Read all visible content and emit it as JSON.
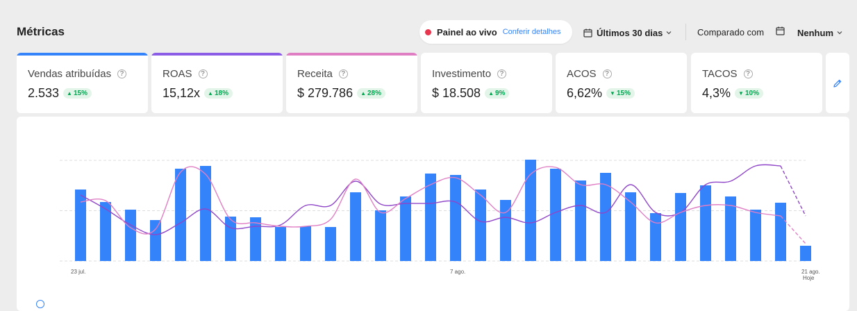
{
  "header": {
    "title": "Métricas",
    "live": {
      "label": "Painel ao vivo",
      "link": "Conferir detalhes"
    },
    "period": {
      "label": "Últimos 30 dias"
    },
    "compare": {
      "label": "Comparado com",
      "value": "Nenhum"
    }
  },
  "colors": {
    "accent_blue": "#3483fa",
    "live_red": "#e8364f",
    "positive_green": "#00a650",
    "line_purple": "#8f46c8",
    "line_pink": "#e07ec4"
  },
  "metrics": [
    {
      "label": "Vendas atribuídas",
      "value": "2.533",
      "change": "15%",
      "direction": "up",
      "accent": "#3483fa"
    },
    {
      "label": "ROAS",
      "value": "15,12x",
      "change": "18%",
      "direction": "up",
      "accent": "#8b5ce6"
    },
    {
      "label": "Receita",
      "value": "$ 279.786",
      "change": "28%",
      "direction": "up",
      "accent": "#e07ec4"
    },
    {
      "label": "Investimento",
      "value": "$ 18.508",
      "change": "9%",
      "direction": "up",
      "accent": ""
    },
    {
      "label": "ACOS",
      "value": "6,62%",
      "change": "15%",
      "direction": "down",
      "accent": ""
    },
    {
      "label": "TACOS",
      "value": "4,3%",
      "change": "10%",
      "direction": "down",
      "accent": ""
    }
  ],
  "chart_data": {
    "type": "bar",
    "x_tick_labels": [
      "23 jul.",
      "7 ago.",
      "21 ago."
    ],
    "today_label": "Hoje",
    "grid": true,
    "series": [
      {
        "type": "bar",
        "color": "#3483fa",
        "values": [
          103,
          85,
          74,
          59,
          133,
          137,
          64,
          63,
          49,
          50,
          49,
          99,
          73,
          93,
          126,
          124,
          103,
          88,
          146,
          133,
          116,
          127,
          99,
          69,
          98,
          109,
          93,
          74,
          84,
          22
        ]
      },
      {
        "type": "line",
        "color": "#8f46c8",
        "values": [
          95,
          75,
          52,
          38,
          55,
          75,
          48,
          50,
          52,
          80,
          80,
          115,
          82,
          83,
          83,
          85,
          57,
          63,
          55,
          70,
          80,
          70,
          110,
          70,
          70,
          110,
          115,
          137,
          137,
          65
        ]
      },
      {
        "type": "line",
        "color": "#e07ec4",
        "values": [
          85,
          87,
          48,
          46,
          128,
          125,
          60,
          55,
          50,
          50,
          60,
          118,
          70,
          90,
          110,
          120,
          95,
          70,
          125,
          135,
          110,
          110,
          85,
          55,
          70,
          80,
          80,
          70,
          65,
          25
        ]
      }
    ],
    "ylim": [
      0,
      145
    ]
  }
}
